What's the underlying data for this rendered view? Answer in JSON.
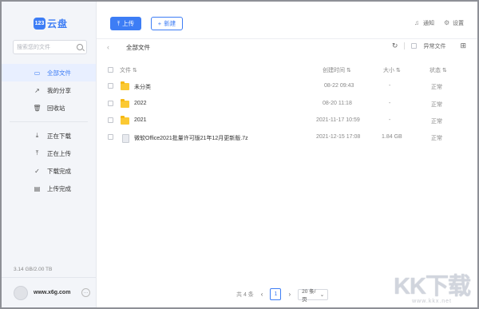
{
  "app": {
    "logo_mark": "123",
    "logo_text": "云盘"
  },
  "sidebar": {
    "search_placeholder": "搜索您的文件",
    "items": [
      {
        "label": "全部文件",
        "icon": "folder-icon",
        "active": true
      },
      {
        "label": "我的分享",
        "icon": "share-icon"
      },
      {
        "label": "回收站",
        "icon": "trash-icon"
      },
      {
        "label": "正在下载",
        "icon": "download-icon"
      },
      {
        "label": "正在上传",
        "icon": "upload-icon"
      },
      {
        "label": "下载完成",
        "icon": "check-circle-icon"
      },
      {
        "label": "上传完成",
        "icon": "doc-icon"
      }
    ],
    "storage": "3.14 GB/2.00 TB",
    "username": "www.x6g.com"
  },
  "toolbar": {
    "upload_label": "上传",
    "new_label": "新建",
    "notify_label": "通知",
    "settings_label": "设置"
  },
  "breadcrumb": {
    "current": "全部文件",
    "abnormal_label": "异常文件"
  },
  "table": {
    "headers": {
      "name": "文件",
      "created": "创建时间",
      "size": "大小",
      "status": "状态"
    },
    "rows": [
      {
        "name": "未分类",
        "type": "folder",
        "created": "08-22 09:43",
        "size": "-",
        "status": "正常"
      },
      {
        "name": "2022",
        "type": "folder",
        "created": "08-20 11:18",
        "size": "-",
        "status": "正常"
      },
      {
        "name": "2021",
        "type": "folder",
        "created": "2021-11-17 10:59",
        "size": "-",
        "status": "正常"
      },
      {
        "name": "微软Office2021批量许可版21年12月更新版.7z",
        "type": "file",
        "created": "2021-12-15 17:08",
        "size": "1.84 GB",
        "status": "正常"
      }
    ]
  },
  "pager": {
    "total": "共 4 条",
    "page": "1",
    "page_size": "20 条/页"
  },
  "watermark": {
    "big": "KK下载",
    "small": "www.kkx.net"
  },
  "colors": {
    "accent": "#3d7df5",
    "folder": "#fbc933"
  }
}
